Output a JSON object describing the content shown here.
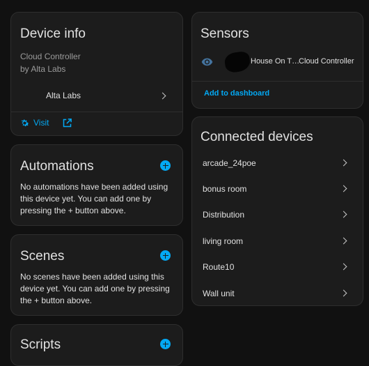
{
  "device_info": {
    "title": "Device info",
    "model": "Cloud Controller",
    "manufacturer_line": "by Alta Labs",
    "parent_device": "Alta Labs",
    "visit_label": "Visit"
  },
  "automations": {
    "title": "Automations",
    "empty_text": "No automations have been added using this device yet. You can add one by pressing the + button above."
  },
  "scenes": {
    "title": "Scenes",
    "empty_text": "No scenes have been added using this device yet. You can add one by pressing the + button above."
  },
  "scripts": {
    "title": "Scripts"
  },
  "sensors": {
    "title": "Sensors",
    "entity_name": "House On T…",
    "entity_state": "Cloud Controller",
    "add_to_dashboard": "Add to dashboard"
  },
  "connected_devices": {
    "title": "Connected devices",
    "items": [
      "arcade_24poe",
      "bonus room",
      "Distribution",
      "living room",
      "Route10",
      "Wall unit"
    ]
  },
  "colors": {
    "accent": "#03a9f4",
    "card": "#1c1c1c",
    "background": "#111111"
  },
  "icons": [
    "chevron-right-icon",
    "gear-icon",
    "open-in-new-icon",
    "plus-circle-icon",
    "eye-icon"
  ]
}
